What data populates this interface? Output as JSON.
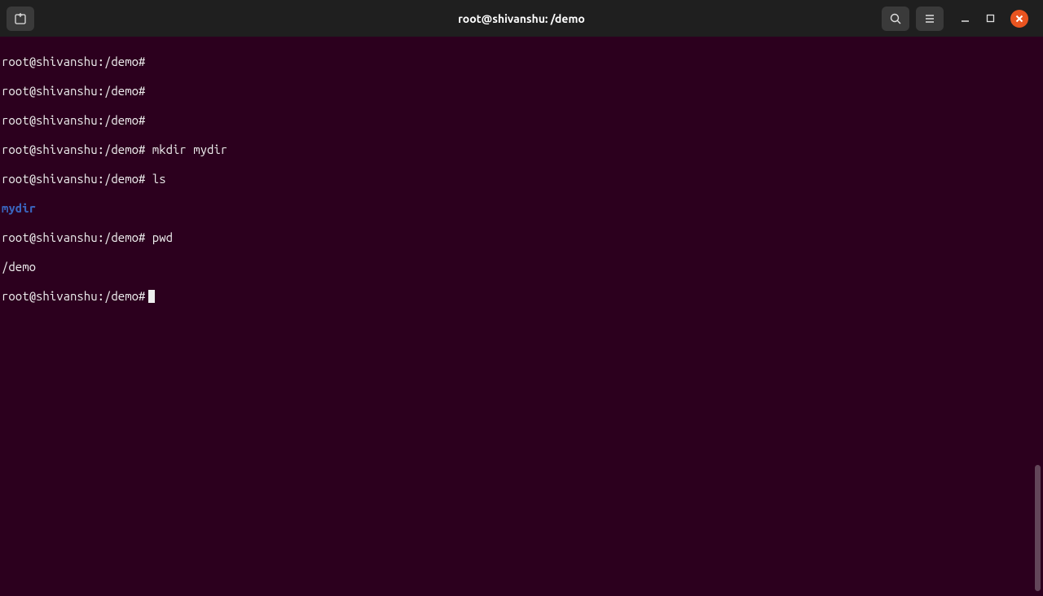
{
  "window": {
    "title": "root@shivanshu: /demo"
  },
  "terminal": {
    "prompt": "root@shivanshu:/demo#",
    "lines": [
      {
        "prompt": "root@shivanshu:/demo#",
        "cmd": ""
      },
      {
        "prompt": "root@shivanshu:/demo#",
        "cmd": ""
      },
      {
        "prompt": "root@shivanshu:/demo#",
        "cmd": ""
      },
      {
        "prompt": "root@shivanshu:/demo#",
        "cmd": " mkdir mydir"
      },
      {
        "prompt": "root@shivanshu:/demo#",
        "cmd": " ls"
      }
    ],
    "ls_output": "mydir",
    "pwd_line": {
      "prompt": "root@shivanshu:/demo#",
      "cmd": " pwd"
    },
    "pwd_output": "/demo",
    "final_prompt": "root@shivanshu:/demo#"
  }
}
